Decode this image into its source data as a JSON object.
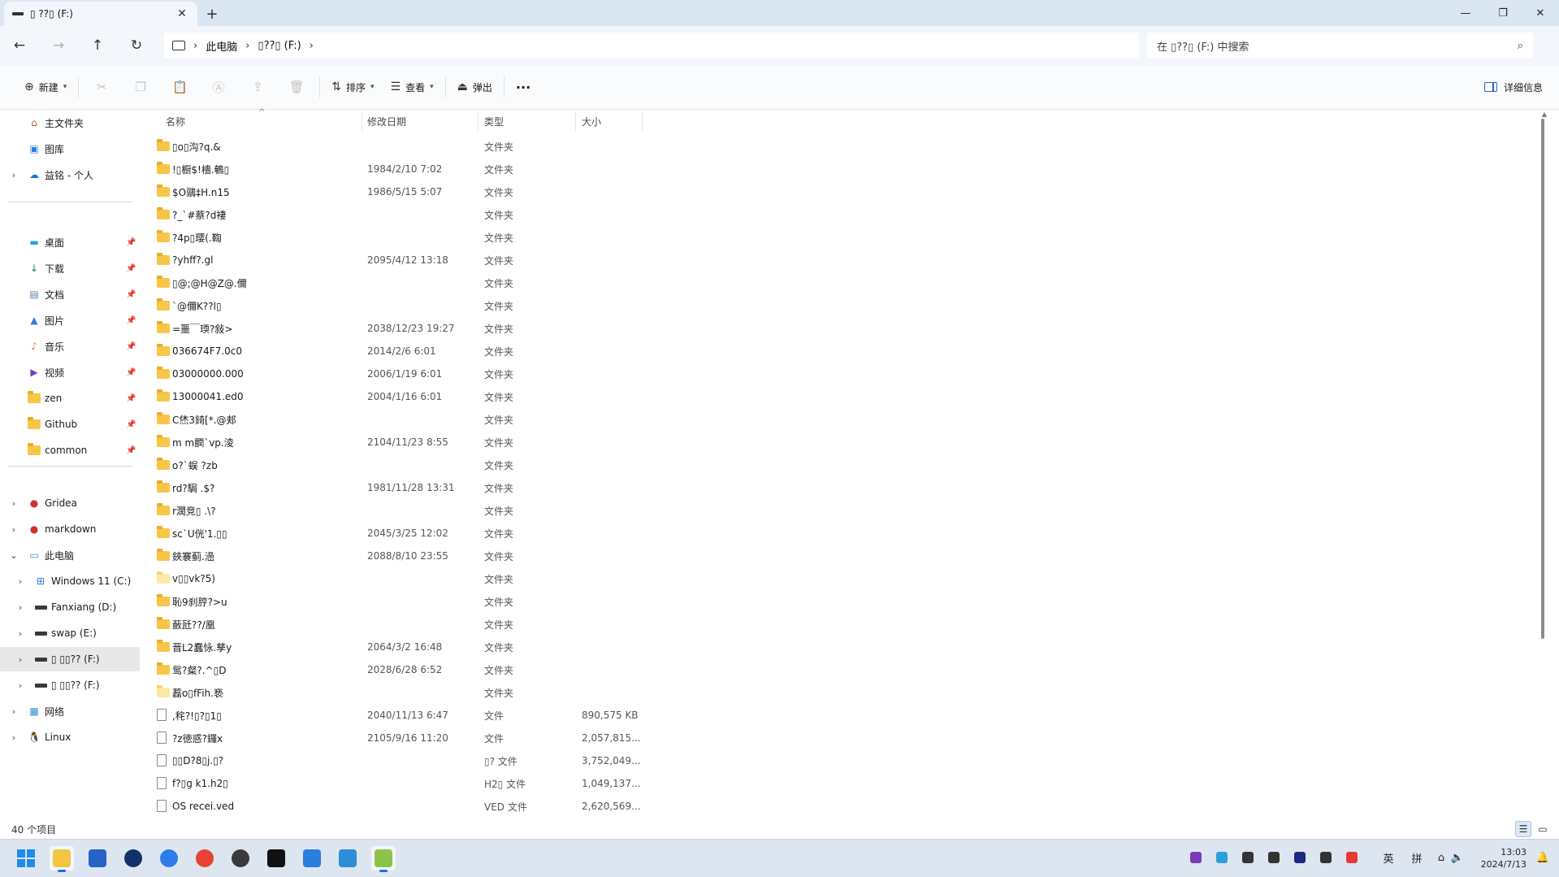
{
  "titlebar": {
    "tab_title": "▯ ??▯ (F:)",
    "close_glyph": "✕",
    "new_tab_glyph": "+",
    "minimize_glyph": "—",
    "restore_glyph": "❐",
    "close_window_glyph": "✕"
  },
  "address": {
    "crumbs": [
      "此电脑",
      "▯??▯ (F:)"
    ],
    "search_placeholder": "在 ▯??▯ (F:) 中搜索"
  },
  "commandbar": {
    "new_label": "新建",
    "sort_label": "排序",
    "view_label": "查看",
    "eject_label": "弹出",
    "more_label": "···",
    "details_label": "详细信息"
  },
  "sidebar": {
    "items": [
      {
        "label": "主文件夹",
        "icon": "home-icon"
      },
      {
        "label": "图库",
        "icon": "gallery-icon"
      },
      {
        "label": "益铭 - 个人",
        "icon": "onedrive-icon",
        "expandable": true
      },
      {
        "label": "桌面",
        "icon": "desktop-icon",
        "pinned": true
      },
      {
        "label": "下载",
        "icon": "download-icon",
        "pinned": true
      },
      {
        "label": "文档",
        "icon": "document-icon",
        "pinned": true
      },
      {
        "label": "图片",
        "icon": "pictures-icon",
        "pinned": true
      },
      {
        "label": "音乐",
        "icon": "music-icon",
        "pinned": true
      },
      {
        "label": "视频",
        "icon": "video-icon",
        "pinned": true
      },
      {
        "label": "zen",
        "icon": "folder-icon",
        "pinned": true
      },
      {
        "label": "Github",
        "icon": "folder-icon",
        "pinned": true
      },
      {
        "label": "common",
        "icon": "folder-icon",
        "pinned": true
      },
      {
        "label": "Gridea",
        "icon": "app-icon",
        "expandable": true
      },
      {
        "label": "markdown",
        "icon": "app-icon",
        "expandable": true
      },
      {
        "label": "此电脑",
        "icon": "pc-icon",
        "expanded": true
      },
      {
        "label": "Windows 11 (C:)",
        "icon": "windows-drive-icon",
        "expandable": true
      },
      {
        "label": "Fanxiang (D:)",
        "icon": "drive-icon",
        "expandable": true
      },
      {
        "label": "swap (E:)",
        "icon": "drive-icon",
        "expandable": true
      },
      {
        "label": "▯  ▯▯??    (F:)",
        "icon": "drive-icon",
        "expandable": true,
        "selected": true
      },
      {
        "label": "▯  ▯▯??    (F:)",
        "icon": "drive-icon",
        "expandable": true
      },
      {
        "label": "网络",
        "icon": "network-icon",
        "expandable": true
      },
      {
        "label": "Linux",
        "icon": "linux-icon",
        "expandable": true
      }
    ]
  },
  "columns": {
    "name": "名称",
    "modified": "修改日期",
    "type": "类型",
    "size": "大小"
  },
  "files": [
    {
      "name": "▯o▯沟?q.&",
      "date": "",
      "type": "文件夹",
      "size": "",
      "kind": "folder"
    },
    {
      "name": "!▯橱$!檣.鵪▯",
      "date": "1984/2/10 7:02",
      "type": "文件夹",
      "size": "",
      "kind": "folder"
    },
    {
      "name": "$O鶸‡H.n15",
      "date": "1986/5/15 5:07",
      "type": "文件夹",
      "size": "",
      "kind": "folder"
    },
    {
      "name": "?_`#蔡?d褄",
      "date": "",
      "type": "文件夹",
      "size": "",
      "kind": "folder"
    },
    {
      "name": "?4p▯璎(.鞫",
      "date": "",
      "type": "文件夹",
      "size": "",
      "kind": "folder"
    },
    {
      "name": "?yhff?.gl",
      "date": "2095/4/12 13:18",
      "type": "文件夹",
      "size": "",
      "kind": "folder"
    },
    {
      "name": "▯@;@H@Z@.儞",
      "date": "",
      "type": "文件夹",
      "size": "",
      "kind": "folder"
    },
    {
      "name": "`@儞K??l▯",
      "date": "",
      "type": "文件夹",
      "size": "",
      "kind": "folder"
    },
    {
      "name": "=噩￣瑌?敍>",
      "date": "2038/12/23 19:27",
      "type": "文件夹",
      "size": "",
      "kind": "folder"
    },
    {
      "name": "036674F7.0c0",
      "date": "2014/2/6 6:01",
      "type": "文件夹",
      "size": "",
      "kind": "folder"
    },
    {
      "name": "03000000.000",
      "date": "2006/1/19 6:01",
      "type": "文件夹",
      "size": "",
      "kind": "folder"
    },
    {
      "name": "13000041.ed0",
      "date": "2004/1/16 6:01",
      "type": "文件夹",
      "size": "",
      "kind": "folder"
    },
    {
      "name": "C烋3錡[*.@郏",
      "date": "",
      "type": "文件夹",
      "size": "",
      "kind": "folder"
    },
    {
      "name": "m m膶`vp.淩",
      "date": "2104/11/23 8:55",
      "type": "文件夹",
      "size": "",
      "kind": "folder"
    },
    {
      "name": "o?`蜈 ?zb",
      "date": "",
      "type": "文件夹",
      "size": "",
      "kind": "folder"
    },
    {
      "name": "rd?駶   .$?",
      "date": "1981/11/28 13:31",
      "type": "文件夹",
      "size": "",
      "kind": "folder"
    },
    {
      "name": "r濶竞▯   .\\?",
      "date": "",
      "type": "文件夹",
      "size": "",
      "kind": "folder"
    },
    {
      "name": "sc`U侊'1.▯▯",
      "date": "2045/3/25 12:02",
      "type": "文件夹",
      "size": "",
      "kind": "folder"
    },
    {
      "name": "   鋏褰蓟.澏",
      "date": "2088/8/10 23:55",
      "type": "文件夹",
      "size": "",
      "kind": "folder"
    },
    {
      "name": "   v▯▯vk?5)",
      "date": "",
      "type": "文件夹",
      "size": "",
      "kind": "folder-light"
    },
    {
      "name": "恥9刹脝?>u",
      "date": "",
      "type": "文件夹",
      "size": "",
      "kind": "folder"
    },
    {
      "name": "蘞瓩??/凰",
      "date": "",
      "type": "文件夹",
      "size": "",
      "kind": "folder"
    },
    {
      "name": "晋L2蠢怺.孳y",
      "date": "2064/3/2 16:48",
      "type": "文件夹",
      "size": "",
      "kind": "folder"
    },
    {
      "name": "鸳?粲?.^▯D",
      "date": "2028/6/28 6:52",
      "type": "文件夹",
      "size": "",
      "kind": "folder"
    },
    {
      "name": "藞o▯fFih.亵",
      "date": "",
      "type": "文件夹",
      "size": "",
      "kind": "folder-light"
    },
    {
      "name": ",秺?!▯?▯1▯",
      "date": "2040/11/13 6:47",
      "type": "文件",
      "size": "890,575 KB",
      "kind": "file"
    },
    {
      "name": "?z徳惑?鑼x",
      "date": "2105/9/16 11:20",
      "type": "文件",
      "size": "2,057,815...",
      "kind": "file"
    },
    {
      "name": "▯▯D?8▯j.▯?",
      "date": "",
      "type": "▯? 文件",
      "size": "3,752,049...",
      "kind": "file"
    },
    {
      "name": "f?▯g k1.h2▯",
      "date": "",
      "type": "H2▯ 文件",
      "size": "1,049,137...",
      "kind": "file"
    },
    {
      "name": "OS recei.ved",
      "date": "",
      "type": "VED 文件",
      "size": "2,620,569...",
      "kind": "file"
    }
  ],
  "status": {
    "count": "40 个项目"
  },
  "taskbar": {
    "time": "13:03",
    "date": "2024/7/13",
    "ime_lang": "英",
    "ime_mode": "拼",
    "apps": [
      {
        "name": "start-button",
        "color": "#1d8cf0"
      },
      {
        "name": "file-explorer-icon",
        "color": "#f5c542",
        "active": true
      },
      {
        "name": "store-icon",
        "color": "#2563c9"
      },
      {
        "name": "media-player-icon",
        "color": "#12306a"
      },
      {
        "name": "browser-blue-icon",
        "color": "#2b7de9"
      },
      {
        "name": "chrome-icon",
        "color": "#e94235"
      },
      {
        "name": "steam-icon",
        "color": "#3a3a3a"
      },
      {
        "name": "chat-app-icon",
        "color": "#111111"
      },
      {
        "name": "todo-app-icon",
        "color": "#2a7de1"
      },
      {
        "name": "triangle-app-icon",
        "color": "#2c8ed6"
      },
      {
        "name": "cube-app-icon",
        "color": "#8bc34a",
        "active": true
      }
    ],
    "tray": [
      {
        "name": "onenote-tray-icon",
        "color": "#7b3bb7"
      },
      {
        "name": "edge-tray-icon",
        "color": "#2b9ee0"
      },
      {
        "name": "onedrive-tray-icon",
        "color": "#333333"
      },
      {
        "name": "usb-tray-icon",
        "color": "#333333"
      },
      {
        "name": "app-tray-icon",
        "color": "#1b2a80"
      },
      {
        "name": "network-tray-icon",
        "color": "#333333"
      },
      {
        "name": "red-app-tray-icon",
        "color": "#e53935"
      }
    ]
  }
}
